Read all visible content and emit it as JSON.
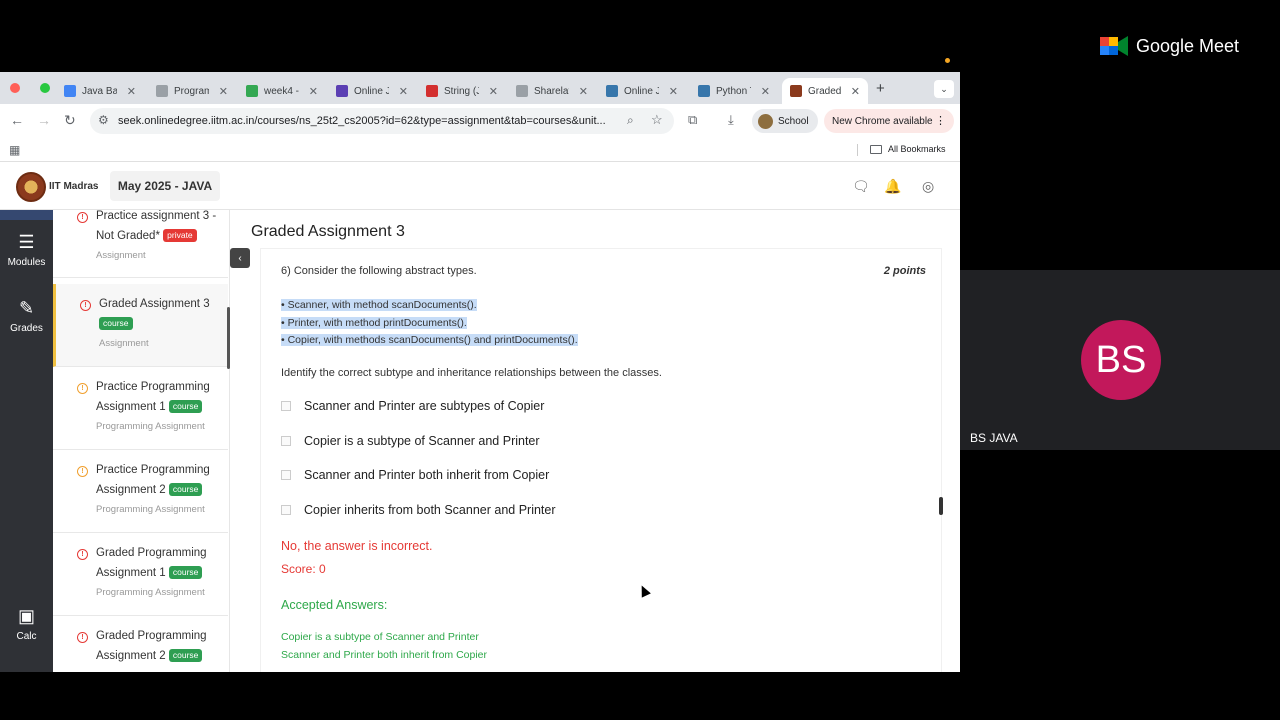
{
  "meet": {
    "brand": "Google Meet",
    "participant_initials": "BS",
    "participant_name": "BS JAVA",
    "avatar_color": "#c2185b"
  },
  "browser": {
    "tabs": [
      {
        "label": "Java Ba",
        "favicon": "docs-icon",
        "color": "#4285f4"
      },
      {
        "label": "Program",
        "favicon": "globe-icon",
        "color": "#9aa0a6"
      },
      {
        "label": "week4 -",
        "favicon": "drive-icon",
        "color": "#34a853"
      },
      {
        "label": "Online J",
        "favicon": "onlinegdb-icon",
        "color": "#5b3fb3"
      },
      {
        "label": "String (J",
        "favicon": "oracle-icon",
        "color": "#d32f2f"
      },
      {
        "label": "Sharelat",
        "favicon": "globe-icon",
        "color": "#9aa0a6"
      },
      {
        "label": "Online J",
        "favicon": "python-icon",
        "color": "#3776ab"
      },
      {
        "label": "Python T",
        "favicon": "python-icon",
        "color": "#3776ab"
      },
      {
        "label": "Graded",
        "favicon": "iitm-icon",
        "color": "#8b3a1d"
      }
    ],
    "url": "seek.onlinedegree.iitm.ac.in/courses/ns_25t2_cs2005?id=62&type=assignment&tab=courses&unit...",
    "profile_label": "School",
    "update_label": "New Chrome available",
    "bookmarks_label": "All Bookmarks"
  },
  "site": {
    "name": "IIT Madras",
    "term": "May 2025 - JAVA"
  },
  "rail": [
    {
      "label": "Modules",
      "icon": "modules-icon"
    },
    {
      "label": "Grades",
      "icon": "grades-icon"
    },
    {
      "label": "Calc",
      "icon": "calculator-icon"
    }
  ],
  "course_list": [
    {
      "title": "Practice assignment 3 - Not Graded*",
      "badge": "private",
      "sub": "Assignment",
      "status": "error"
    },
    {
      "title": "Graded Assignment 3",
      "badge": "course",
      "sub": "Assignment",
      "status": "error"
    },
    {
      "title": "Practice Programming Assignment 1",
      "badge": "course",
      "sub": "Programming Assignment",
      "status": "warn"
    },
    {
      "title": "Practice Programming Assignment 2",
      "badge": "course",
      "sub": "Programming Assignment",
      "status": "warn"
    },
    {
      "title": "Graded Programming Assignment 1",
      "badge": "course",
      "sub": "Programming Assignment",
      "status": "error"
    },
    {
      "title": "Graded Programming Assignment 2",
      "badge": "course",
      "sub": "",
      "status": "error"
    }
  ],
  "main": {
    "title": "Graded Assignment 3",
    "question": "6)  Consider the following abstract types.",
    "points": "2 points",
    "types": [
      "• Scanner, with method scanDocuments().",
      "• Printer, with method printDocuments().",
      "• Copier, with methods scanDocuments() and printDocuments()."
    ],
    "prompt": "Identify the correct subtype and inheritance relationships between the classes.",
    "options": [
      "Scanner and Printer are subtypes of Copier",
      "Copier is a subtype of Scanner and Printer",
      "Scanner and Printer both inherit from Copier",
      "Copier inherits from both Scanner and Printer"
    ],
    "feedback": "No, the answer is incorrect.",
    "score": "Score: 0",
    "accepted_title": "Accepted Answers:",
    "accepted": [
      "Copier is a subtype of Scanner and Printer",
      "Scanner and Printer both inherit from Copier"
    ]
  }
}
